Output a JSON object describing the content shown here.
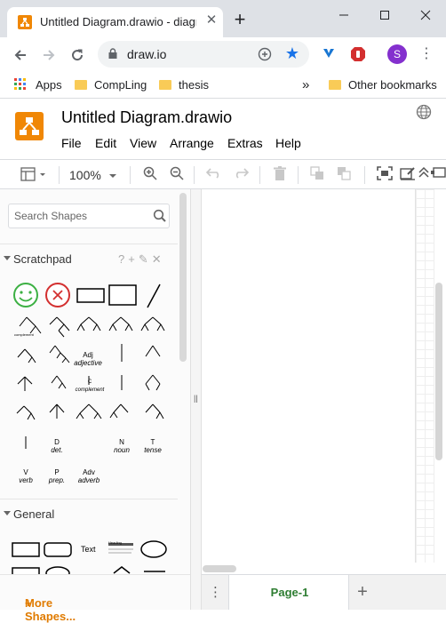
{
  "browser": {
    "tab_title": "Untitled Diagram.drawio - diagrams.net",
    "url": "draw.io",
    "profile_initial": "S",
    "bookmarks": [
      {
        "label": "Apps",
        "icon": "apps-grid-icon"
      },
      {
        "label": "CompLing",
        "icon": "folder-icon"
      },
      {
        "label": "thesis",
        "icon": "folder-icon"
      }
    ],
    "bookmarks_overflow": "»",
    "other_bookmarks": "Other bookmarks"
  },
  "app": {
    "doc_title": "Untitled Diagram.drawio",
    "menus": [
      "File",
      "Edit",
      "View",
      "Arrange",
      "Extras",
      "Help"
    ],
    "accent_color": "#f08705"
  },
  "toolbar": {
    "zoom": "100%"
  },
  "sidebar": {
    "search_placeholder": "Search Shapes",
    "scratchpad_label": "Scratchpad",
    "scratchpad_actions": "?+✎✕",
    "general_label": "General",
    "more_shapes": "More Shapes...",
    "shape_labels": [
      {
        "top": "Adj",
        "bottom": "adjective"
      },
      {
        "top": "Adv",
        "bottom": "adverb"
      },
      {
        "top": "N",
        "bottom": "noun"
      },
      {
        "top": "T",
        "bottom": "tense"
      },
      {
        "top": "V",
        "bottom": "verb"
      },
      {
        "top": "P",
        "bottom": "prep."
      },
      {
        "top": "D",
        "bottom": "det."
      },
      {
        "top": "C",
        "bottom": "complement"
      }
    ],
    "general_text_shape": "Text",
    "general_heading_shape": "Heading"
  },
  "pages": {
    "current": "Page-1"
  }
}
